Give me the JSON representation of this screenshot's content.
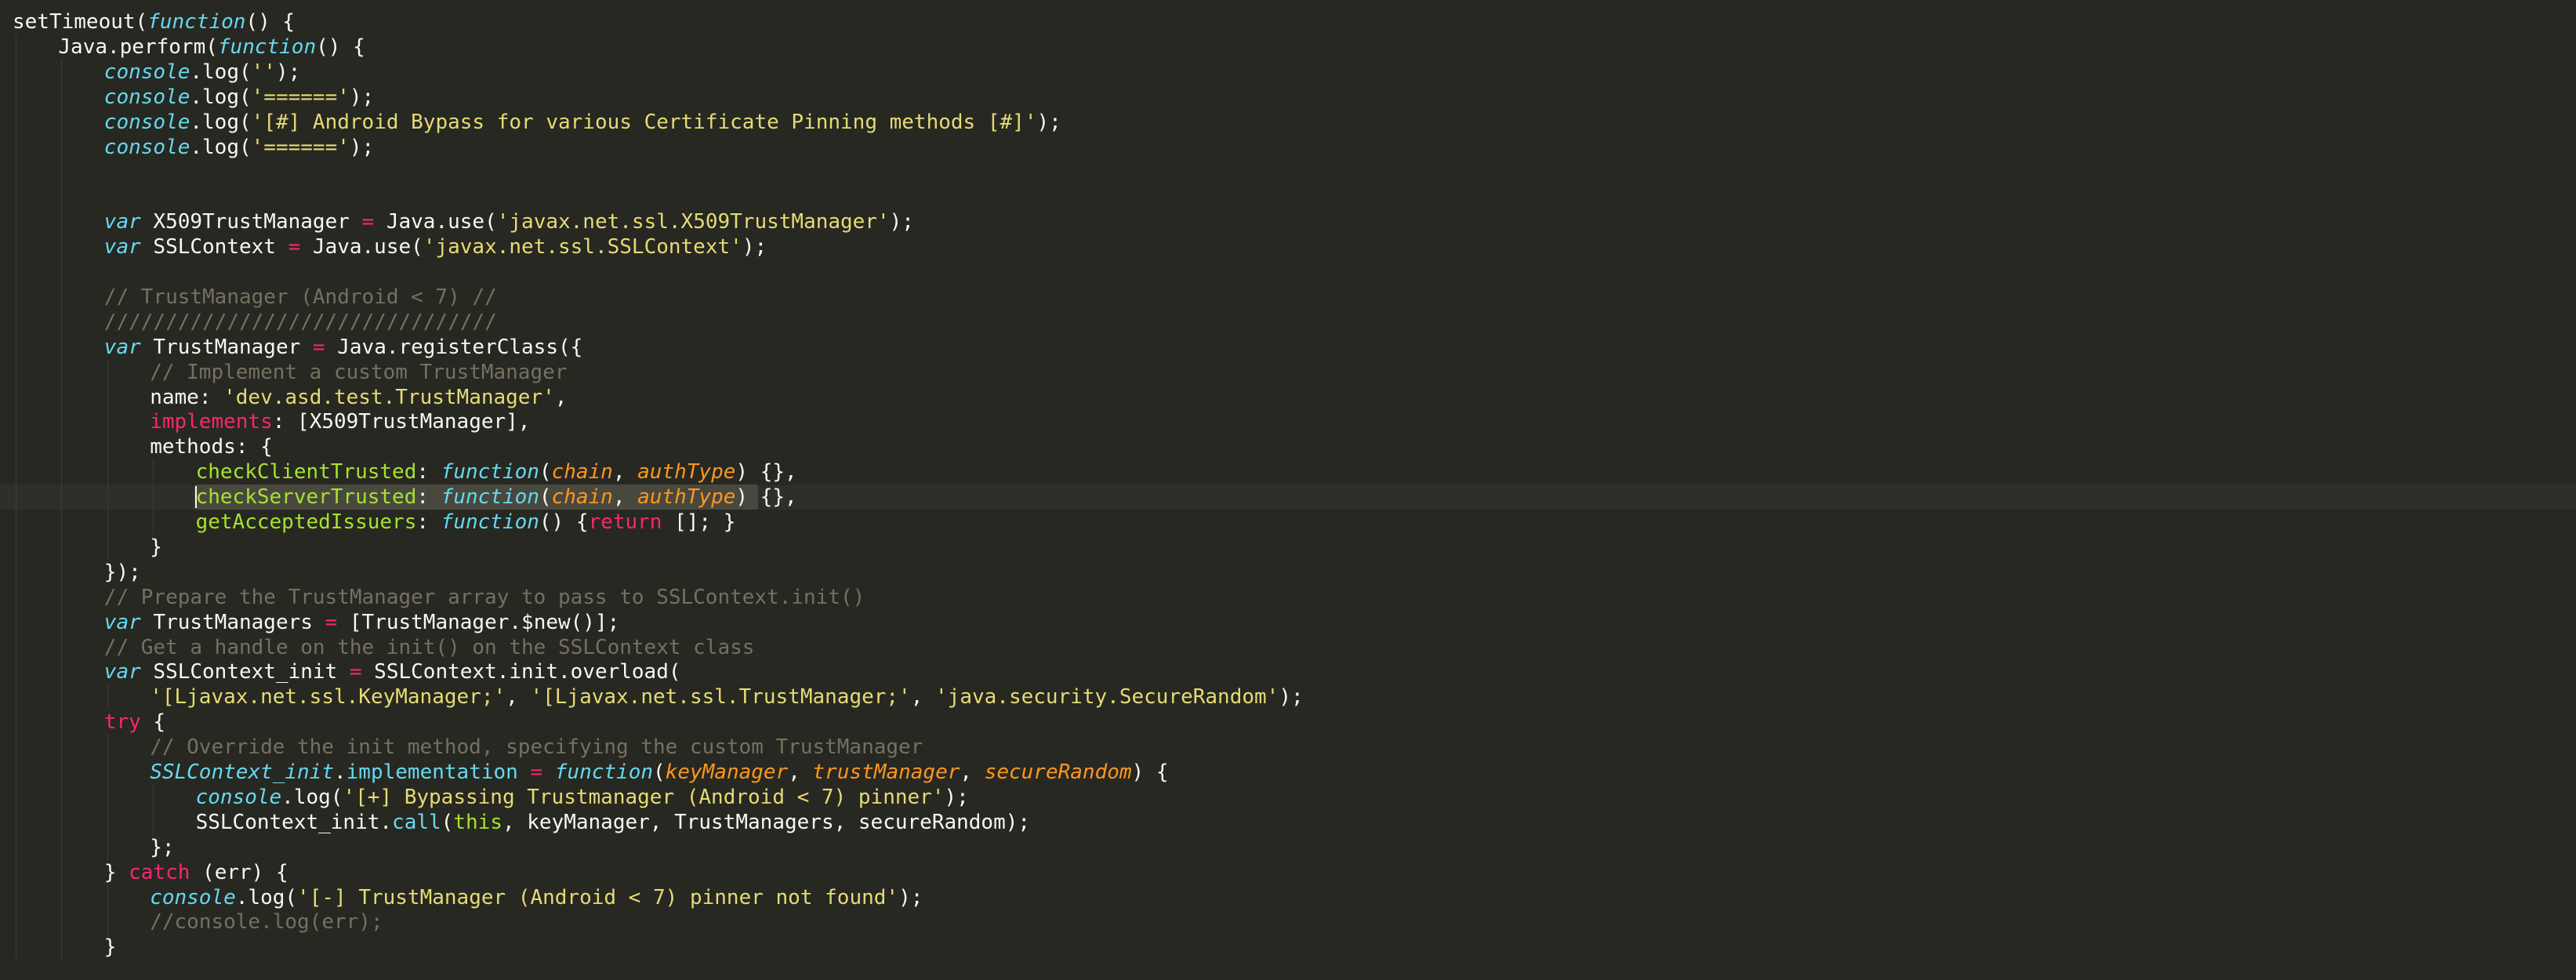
{
  "editor": {
    "theme": "monokai",
    "background": "#272822",
    "current_line": 19,
    "selection_line": 19,
    "colors": {
      "plain": "#f8f8f2",
      "keyword": "#f92672",
      "storage": "#66d9ef",
      "string": "#e6db74",
      "comment": "#75715e",
      "parameter": "#fd971f",
      "method": "#a6e22e"
    },
    "lines": [
      {
        "indent": 0,
        "tokens": [
          {
            "t": "setTimeout(",
            "c": "pl"
          },
          {
            "t": "function",
            "c": "fn"
          },
          {
            "t": "() {",
            "c": "pl"
          }
        ]
      },
      {
        "indent": 1,
        "tokens": [
          {
            "t": "Java.perform(",
            "c": "pl"
          },
          {
            "t": "function",
            "c": "fn"
          },
          {
            "t": "() {",
            "c": "pl"
          }
        ]
      },
      {
        "indent": 2,
        "tokens": [
          {
            "t": "console",
            "c": "cn"
          },
          {
            "t": ".log(",
            "c": "pl"
          },
          {
            "t": "''",
            "c": "st"
          },
          {
            "t": ");",
            "c": "pl"
          }
        ]
      },
      {
        "indent": 2,
        "tokens": [
          {
            "t": "console",
            "c": "cn"
          },
          {
            "t": ".log(",
            "c": "pl"
          },
          {
            "t": "'======'",
            "c": "st"
          },
          {
            "t": ");",
            "c": "pl"
          }
        ]
      },
      {
        "indent": 2,
        "tokens": [
          {
            "t": "console",
            "c": "cn"
          },
          {
            "t": ".log(",
            "c": "pl"
          },
          {
            "t": "'[#] Android Bypass for various Certificate Pinning methods [#]'",
            "c": "st"
          },
          {
            "t": ");",
            "c": "pl"
          }
        ]
      },
      {
        "indent": 2,
        "tokens": [
          {
            "t": "console",
            "c": "cn"
          },
          {
            "t": ".log(",
            "c": "pl"
          },
          {
            "t": "'======'",
            "c": "st"
          },
          {
            "t": ");",
            "c": "pl"
          }
        ]
      },
      {
        "indent": 2,
        "tokens": []
      },
      {
        "indent": 2,
        "tokens": []
      },
      {
        "indent": 2,
        "tokens": [
          {
            "t": "var",
            "c": "fd"
          },
          {
            "t": " X509TrustManager ",
            "c": "pl"
          },
          {
            "t": "=",
            "c": "kw"
          },
          {
            "t": " Java.use(",
            "c": "pl"
          },
          {
            "t": "'javax.net.ssl.X509TrustManager'",
            "c": "st"
          },
          {
            "t": ");",
            "c": "pl"
          }
        ]
      },
      {
        "indent": 2,
        "tokens": [
          {
            "t": "var",
            "c": "fd"
          },
          {
            "t": " SSLContext ",
            "c": "pl"
          },
          {
            "t": "=",
            "c": "kw"
          },
          {
            "t": " Java.use(",
            "c": "pl"
          },
          {
            "t": "'javax.net.ssl.SSLContext'",
            "c": "st"
          },
          {
            "t": ");",
            "c": "pl"
          }
        ]
      },
      {
        "indent": 2,
        "tokens": []
      },
      {
        "indent": 2,
        "tokens": [
          {
            "t": "// TrustManager (Android < 7) //",
            "c": "cm"
          }
        ]
      },
      {
        "indent": 2,
        "tokens": [
          {
            "t": "////////////////////////////////",
            "c": "cm"
          }
        ]
      },
      {
        "indent": 2,
        "tokens": [
          {
            "t": "var",
            "c": "fd"
          },
          {
            "t": " TrustManager ",
            "c": "pl"
          },
          {
            "t": "=",
            "c": "kw"
          },
          {
            "t": " Java.registerClass({",
            "c": "pl"
          }
        ]
      },
      {
        "indent": 3,
        "tokens": [
          {
            "t": "// Implement a custom TrustManager",
            "c": "cm"
          }
        ]
      },
      {
        "indent": 3,
        "tokens": [
          {
            "t": "name",
            "c": "pl"
          },
          {
            "t": ": ",
            "c": "pl"
          },
          {
            "t": "'dev.asd.test.TrustManager'",
            "c": "st"
          },
          {
            "t": ",",
            "c": "pl"
          }
        ]
      },
      {
        "indent": 3,
        "tokens": [
          {
            "t": "implements",
            "c": "kw"
          },
          {
            "t": ": [X509TrustManager],",
            "c": "pl"
          }
        ]
      },
      {
        "indent": 3,
        "tokens": [
          {
            "t": "methods: {",
            "c": "pl"
          }
        ]
      },
      {
        "indent": 4,
        "tokens": [
          {
            "t": "checkClientTrusted",
            "c": "me"
          },
          {
            "t": ": ",
            "c": "pl"
          },
          {
            "t": "function",
            "c": "fn"
          },
          {
            "t": "(",
            "c": "pl"
          },
          {
            "t": "chain",
            "c": "pr"
          },
          {
            "t": ", ",
            "c": "pl"
          },
          {
            "t": "authType",
            "c": "pr"
          },
          {
            "t": ") {},",
            "c": "pl"
          }
        ]
      },
      {
        "indent": 4,
        "tokens": [
          {
            "t": "checkServerTrusted",
            "c": "me"
          },
          {
            "t": ": ",
            "c": "pl"
          },
          {
            "t": "function",
            "c": "fn"
          },
          {
            "t": "(",
            "c": "pl"
          },
          {
            "t": "chain",
            "c": "pr"
          },
          {
            "t": ", ",
            "c": "pl"
          },
          {
            "t": "authType",
            "c": "pr"
          },
          {
            "t": ") {},",
            "c": "pl"
          }
        ]
      },
      {
        "indent": 4,
        "tokens": [
          {
            "t": "getAcceptedIssuers",
            "c": "me"
          },
          {
            "t": ": ",
            "c": "pl"
          },
          {
            "t": "function",
            "c": "fn"
          },
          {
            "t": "() {",
            "c": "pl"
          },
          {
            "t": "return",
            "c": "kw"
          },
          {
            "t": " []; }",
            "c": "pl"
          }
        ]
      },
      {
        "indent": 3,
        "tokens": [
          {
            "t": "}",
            "c": "pl"
          }
        ]
      },
      {
        "indent": 2,
        "tokens": [
          {
            "t": "});",
            "c": "pl"
          }
        ]
      },
      {
        "indent": 2,
        "tokens": [
          {
            "t": "// Prepare the TrustManager array to pass to SSLContext.init()",
            "c": "cm"
          }
        ]
      },
      {
        "indent": 2,
        "tokens": [
          {
            "t": "var",
            "c": "fd"
          },
          {
            "t": " TrustManagers ",
            "c": "pl"
          },
          {
            "t": "=",
            "c": "kw"
          },
          {
            "t": " [TrustManager.$new()];",
            "c": "pl"
          }
        ]
      },
      {
        "indent": 2,
        "tokens": [
          {
            "t": "// Get a handle on the init() on the SSLContext class",
            "c": "cm"
          }
        ]
      },
      {
        "indent": 2,
        "tokens": [
          {
            "t": "var",
            "c": "fd"
          },
          {
            "t": " SSLContext_init ",
            "c": "pl"
          },
          {
            "t": "=",
            "c": "kw"
          },
          {
            "t": " SSLContext.init.overload(",
            "c": "pl"
          }
        ]
      },
      {
        "indent": 3,
        "tokens": [
          {
            "t": "'[Ljavax.net.ssl.KeyManager;'",
            "c": "st"
          },
          {
            "t": ", ",
            "c": "pl"
          },
          {
            "t": "'[Ljavax.net.ssl.TrustManager;'",
            "c": "st"
          },
          {
            "t": ", ",
            "c": "pl"
          },
          {
            "t": "'java.security.SecureRandom'",
            "c": "st"
          },
          {
            "t": ");",
            "c": "pl"
          }
        ]
      },
      {
        "indent": 2,
        "tokens": [
          {
            "t": "try",
            "c": "kw"
          },
          {
            "t": " {",
            "c": "pl"
          }
        ]
      },
      {
        "indent": 3,
        "tokens": [
          {
            "t": "// Override the init method, specifying the custom TrustManager",
            "c": "cm"
          }
        ]
      },
      {
        "indent": 3,
        "tokens": [
          {
            "t": "SSLContext_init",
            "c": "cn"
          },
          {
            "t": ".",
            "c": "pl"
          },
          {
            "t": "implementation",
            "c": "bi"
          },
          {
            "t": " ",
            "c": "pl"
          },
          {
            "t": "=",
            "c": "kw"
          },
          {
            "t": " ",
            "c": "pl"
          },
          {
            "t": "function",
            "c": "fn"
          },
          {
            "t": "(",
            "c": "pl"
          },
          {
            "t": "keyManager",
            "c": "pr"
          },
          {
            "t": ", ",
            "c": "pl"
          },
          {
            "t": "trustManager",
            "c": "pr"
          },
          {
            "t": ", ",
            "c": "pl"
          },
          {
            "t": "secureRandom",
            "c": "pr"
          },
          {
            "t": ") {",
            "c": "pl"
          }
        ]
      },
      {
        "indent": 4,
        "tokens": [
          {
            "t": "console",
            "c": "cn"
          },
          {
            "t": ".log(",
            "c": "pl"
          },
          {
            "t": "'[+] Bypassing Trustmanager (Android < 7) pinner'",
            "c": "st"
          },
          {
            "t": ");",
            "c": "pl"
          }
        ]
      },
      {
        "indent": 4,
        "tokens": [
          {
            "t": "SSLContext_init.",
            "c": "pl"
          },
          {
            "t": "call",
            "c": "bi"
          },
          {
            "t": "(",
            "c": "pl"
          },
          {
            "t": "this",
            "c": "me"
          },
          {
            "t": ", keyManager, TrustManagers, secureRandom);",
            "c": "pl"
          }
        ]
      },
      {
        "indent": 3,
        "tokens": [
          {
            "t": "};",
            "c": "pl"
          }
        ]
      },
      {
        "indent": 2,
        "tokens": [
          {
            "t": "} ",
            "c": "pl"
          },
          {
            "t": "catch",
            "c": "kw"
          },
          {
            "t": " (err) {",
            "c": "pl"
          }
        ]
      },
      {
        "indent": 3,
        "tokens": [
          {
            "t": "console",
            "c": "cn"
          },
          {
            "t": ".log(",
            "c": "pl"
          },
          {
            "t": "'[-] TrustManager (Android < 7) pinner not found'",
            "c": "st"
          },
          {
            "t": ");",
            "c": "pl"
          }
        ]
      },
      {
        "indent": 3,
        "tokens": [
          {
            "t": "//console.log(err);",
            "c": "cm"
          }
        ]
      },
      {
        "indent": 2,
        "tokens": [
          {
            "t": "}",
            "c": "pl"
          }
        ]
      }
    ]
  }
}
